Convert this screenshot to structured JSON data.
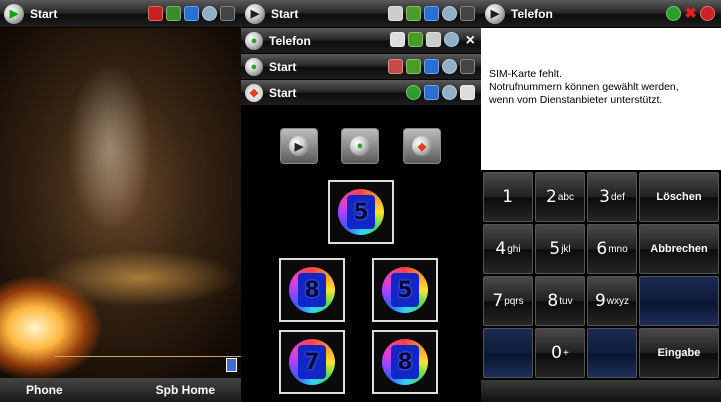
{
  "panel1": {
    "title": "Start",
    "status_icons": [
      "phone-off-icon",
      "signal-icon",
      "connection-icon",
      "sound-icon",
      "battery-icon"
    ],
    "softkeys": {
      "left": "Phone",
      "right": "Spb Home"
    }
  },
  "panel2": {
    "title_bar": {
      "title": "Start",
      "icons": [
        "message-icon",
        "sync-icon",
        "signal-icon",
        "sound-icon",
        "battery-icon"
      ]
    },
    "taskbar": [
      {
        "title": "Telefon",
        "icons": [
          "bluetooth-icon",
          "sync-icon",
          "phone-icon",
          "sound-icon"
        ],
        "close": "×"
      },
      {
        "title": "Start",
        "icons": [
          "contacts-icon",
          "signal-3g-icon",
          "signal-icon",
          "sound-icon",
          "battery-icon"
        ]
      },
      {
        "title": "Start",
        "icons": [
          "phone-green-icon",
          "signal-icon",
          "clock-icon",
          "display-icon"
        ]
      }
    ],
    "tiles": [
      "5",
      "8",
      "5",
      "7",
      "8"
    ]
  },
  "panel3": {
    "title": "Telefon",
    "message_lines": [
      "SIM-Karte fehlt.",
      "Notrufnummern können gewählt werden,",
      "wenn vom Dienstanbieter unterstützt."
    ],
    "keys": [
      {
        "digit": "1",
        "letters": ""
      },
      {
        "digit": "2",
        "letters": "abc"
      },
      {
        "digit": "3",
        "letters": "def"
      },
      {
        "digit": "4",
        "letters": "ghi"
      },
      {
        "digit": "5",
        "letters": "jkl"
      },
      {
        "digit": "6",
        "letters": "mno"
      },
      {
        "digit": "7",
        "letters": "pqrs"
      },
      {
        "digit": "8",
        "letters": "tuv"
      },
      {
        "digit": "9",
        "letters": "wxyz"
      },
      {
        "digit": "0",
        "letters": "+"
      }
    ],
    "actions": {
      "delete": "Löschen",
      "cancel": "Abbrechen",
      "enter": "Eingabe"
    }
  }
}
